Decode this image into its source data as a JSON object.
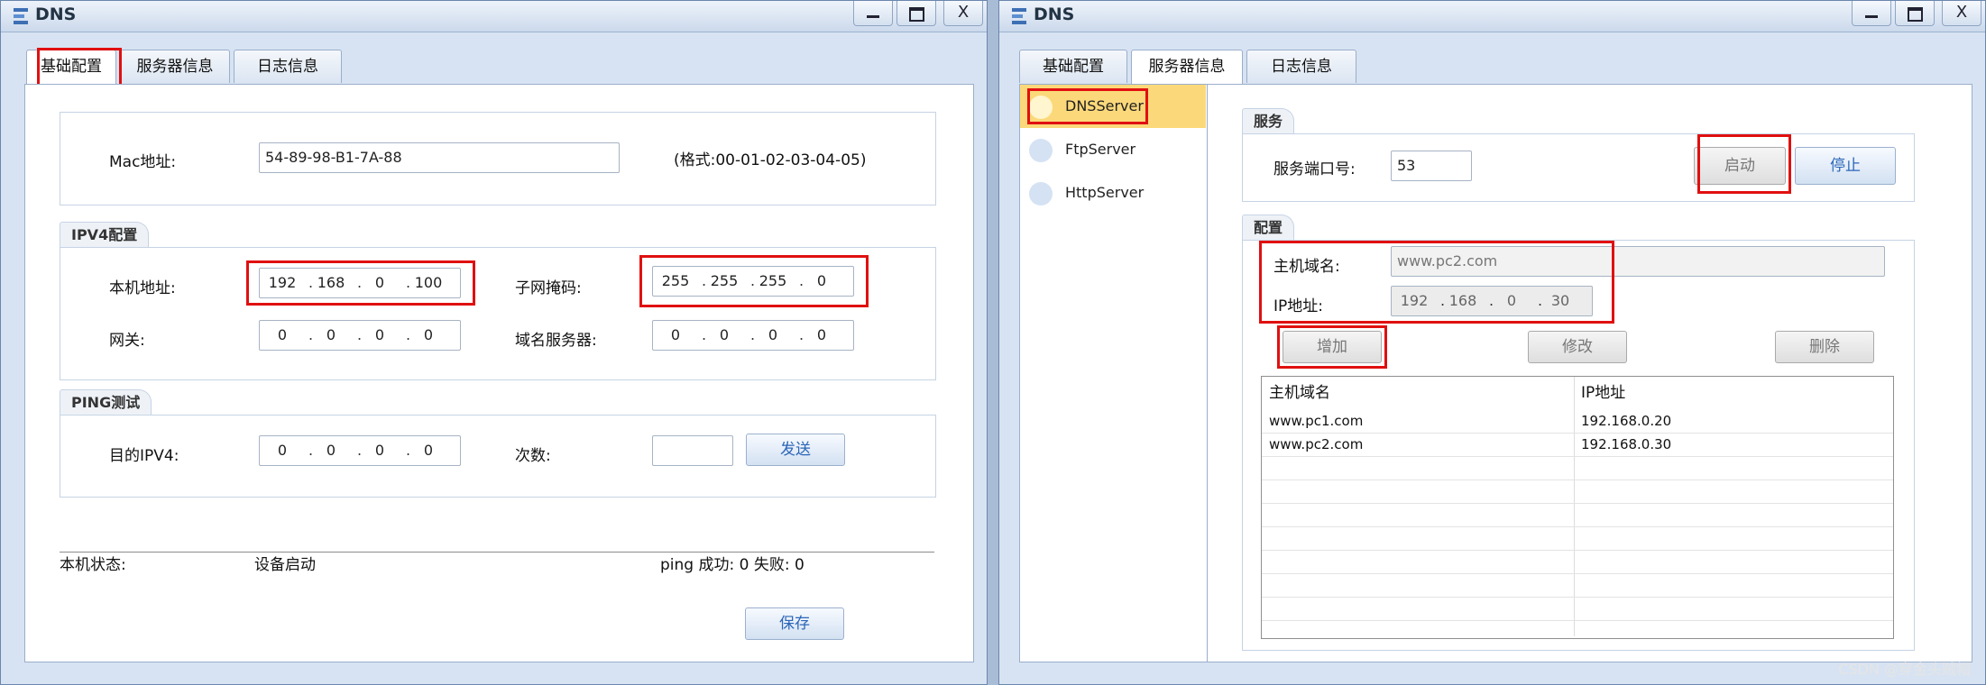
{
  "left_window": {
    "title": "DNS",
    "tabs": [
      "基础配置",
      "服务器信息",
      "日志信息"
    ],
    "mac": {
      "label": "Mac地址:",
      "value": "54-89-98-B1-7A-88",
      "hint": "(格式:00-01-02-03-04-05)"
    },
    "ipv4": {
      "legend": "IPV4配置",
      "local_label": "本机地址:",
      "local_ip": [
        "192",
        "168",
        "0",
        "100"
      ],
      "mask_label": "子网掩码:",
      "mask": [
        "255",
        "255",
        "255",
        "0"
      ],
      "gateway_label": "网关:",
      "gateway": [
        "0",
        "0",
        "0",
        "0"
      ],
      "dns_label": "域名服务器:",
      "dns": [
        "0",
        "0",
        "0",
        "0"
      ]
    },
    "ping": {
      "legend": "PING测试",
      "target_label": "目的IPV4:",
      "target": [
        "0",
        "0",
        "0",
        "0"
      ],
      "count_label": "次数:",
      "count": "",
      "send_button": "发送"
    },
    "status": {
      "label": "本机状态:",
      "value": "设备启动",
      "ping_result": "ping 成功: 0 失败: 0"
    },
    "save_button": "保存"
  },
  "right_window": {
    "title": "DNS",
    "tabs": [
      "基础配置",
      "服务器信息",
      "日志信息"
    ],
    "servers": [
      "DNSServer",
      "FtpServer",
      "HttpServer"
    ],
    "service": {
      "legend": "服务",
      "port_label": "服务端口号:",
      "port": "53",
      "start_button": "启动",
      "stop_button": "停止"
    },
    "config": {
      "legend": "配置",
      "host_label": "主机域名:",
      "host_value": "www.pc2.com",
      "ip_label": "IP地址:",
      "ip": [
        "192",
        "168",
        "0",
        "30"
      ],
      "add_button": "增加",
      "modify_button": "修改",
      "delete_button": "删除"
    },
    "table": {
      "headers": [
        "主机域名",
        "IP地址"
      ],
      "rows": [
        [
          "www.pc1.com",
          "192.168.0.20"
        ],
        [
          "www.pc2.com",
          "192.168.0.30"
        ]
      ]
    }
  },
  "watermark": "CSDN @穿金头贼帽",
  "colors": {
    "highlight": "#e01010",
    "selected_server": "#fbd97a",
    "button_text": "#2b66b8"
  }
}
